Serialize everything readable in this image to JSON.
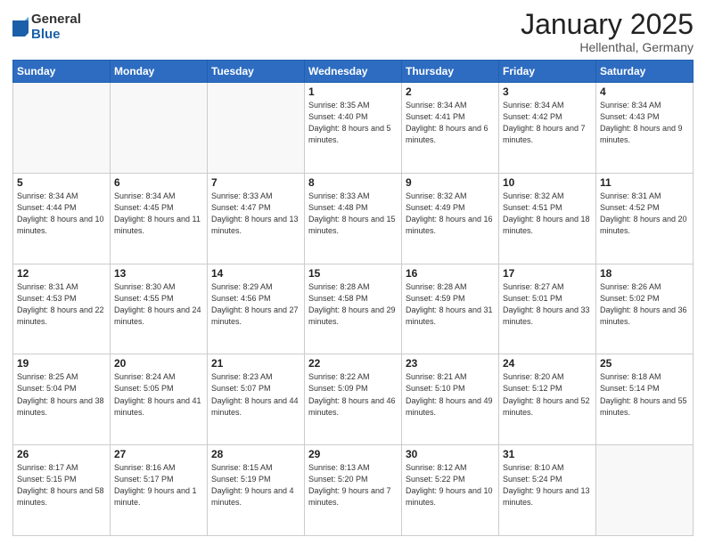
{
  "logo": {
    "general": "General",
    "blue": "Blue"
  },
  "header": {
    "month": "January 2025",
    "location": "Hellenthal, Germany"
  },
  "weekdays": [
    "Sunday",
    "Monday",
    "Tuesday",
    "Wednesday",
    "Thursday",
    "Friday",
    "Saturday"
  ],
  "weeks": [
    [
      {
        "day": "",
        "info": ""
      },
      {
        "day": "",
        "info": ""
      },
      {
        "day": "",
        "info": ""
      },
      {
        "day": "1",
        "info": "Sunrise: 8:35 AM\nSunset: 4:40 PM\nDaylight: 8 hours\nand 5 minutes."
      },
      {
        "day": "2",
        "info": "Sunrise: 8:34 AM\nSunset: 4:41 PM\nDaylight: 8 hours\nand 6 minutes."
      },
      {
        "day": "3",
        "info": "Sunrise: 8:34 AM\nSunset: 4:42 PM\nDaylight: 8 hours\nand 7 minutes."
      },
      {
        "day": "4",
        "info": "Sunrise: 8:34 AM\nSunset: 4:43 PM\nDaylight: 8 hours\nand 9 minutes."
      }
    ],
    [
      {
        "day": "5",
        "info": "Sunrise: 8:34 AM\nSunset: 4:44 PM\nDaylight: 8 hours\nand 10 minutes."
      },
      {
        "day": "6",
        "info": "Sunrise: 8:34 AM\nSunset: 4:45 PM\nDaylight: 8 hours\nand 11 minutes."
      },
      {
        "day": "7",
        "info": "Sunrise: 8:33 AM\nSunset: 4:47 PM\nDaylight: 8 hours\nand 13 minutes."
      },
      {
        "day": "8",
        "info": "Sunrise: 8:33 AM\nSunset: 4:48 PM\nDaylight: 8 hours\nand 15 minutes."
      },
      {
        "day": "9",
        "info": "Sunrise: 8:32 AM\nSunset: 4:49 PM\nDaylight: 8 hours\nand 16 minutes."
      },
      {
        "day": "10",
        "info": "Sunrise: 8:32 AM\nSunset: 4:51 PM\nDaylight: 8 hours\nand 18 minutes."
      },
      {
        "day": "11",
        "info": "Sunrise: 8:31 AM\nSunset: 4:52 PM\nDaylight: 8 hours\nand 20 minutes."
      }
    ],
    [
      {
        "day": "12",
        "info": "Sunrise: 8:31 AM\nSunset: 4:53 PM\nDaylight: 8 hours\nand 22 minutes."
      },
      {
        "day": "13",
        "info": "Sunrise: 8:30 AM\nSunset: 4:55 PM\nDaylight: 8 hours\nand 24 minutes."
      },
      {
        "day": "14",
        "info": "Sunrise: 8:29 AM\nSunset: 4:56 PM\nDaylight: 8 hours\nand 27 minutes."
      },
      {
        "day": "15",
        "info": "Sunrise: 8:28 AM\nSunset: 4:58 PM\nDaylight: 8 hours\nand 29 minutes."
      },
      {
        "day": "16",
        "info": "Sunrise: 8:28 AM\nSunset: 4:59 PM\nDaylight: 8 hours\nand 31 minutes."
      },
      {
        "day": "17",
        "info": "Sunrise: 8:27 AM\nSunset: 5:01 PM\nDaylight: 8 hours\nand 33 minutes."
      },
      {
        "day": "18",
        "info": "Sunrise: 8:26 AM\nSunset: 5:02 PM\nDaylight: 8 hours\nand 36 minutes."
      }
    ],
    [
      {
        "day": "19",
        "info": "Sunrise: 8:25 AM\nSunset: 5:04 PM\nDaylight: 8 hours\nand 38 minutes."
      },
      {
        "day": "20",
        "info": "Sunrise: 8:24 AM\nSunset: 5:05 PM\nDaylight: 8 hours\nand 41 minutes."
      },
      {
        "day": "21",
        "info": "Sunrise: 8:23 AM\nSunset: 5:07 PM\nDaylight: 8 hours\nand 44 minutes."
      },
      {
        "day": "22",
        "info": "Sunrise: 8:22 AM\nSunset: 5:09 PM\nDaylight: 8 hours\nand 46 minutes."
      },
      {
        "day": "23",
        "info": "Sunrise: 8:21 AM\nSunset: 5:10 PM\nDaylight: 8 hours\nand 49 minutes."
      },
      {
        "day": "24",
        "info": "Sunrise: 8:20 AM\nSunset: 5:12 PM\nDaylight: 8 hours\nand 52 minutes."
      },
      {
        "day": "25",
        "info": "Sunrise: 8:18 AM\nSunset: 5:14 PM\nDaylight: 8 hours\nand 55 minutes."
      }
    ],
    [
      {
        "day": "26",
        "info": "Sunrise: 8:17 AM\nSunset: 5:15 PM\nDaylight: 8 hours\nand 58 minutes."
      },
      {
        "day": "27",
        "info": "Sunrise: 8:16 AM\nSunset: 5:17 PM\nDaylight: 9 hours\nand 1 minute."
      },
      {
        "day": "28",
        "info": "Sunrise: 8:15 AM\nSunset: 5:19 PM\nDaylight: 9 hours\nand 4 minutes."
      },
      {
        "day": "29",
        "info": "Sunrise: 8:13 AM\nSunset: 5:20 PM\nDaylight: 9 hours\nand 7 minutes."
      },
      {
        "day": "30",
        "info": "Sunrise: 8:12 AM\nSunset: 5:22 PM\nDaylight: 9 hours\nand 10 minutes."
      },
      {
        "day": "31",
        "info": "Sunrise: 8:10 AM\nSunset: 5:24 PM\nDaylight: 9 hours\nand 13 minutes."
      },
      {
        "day": "",
        "info": ""
      }
    ]
  ]
}
